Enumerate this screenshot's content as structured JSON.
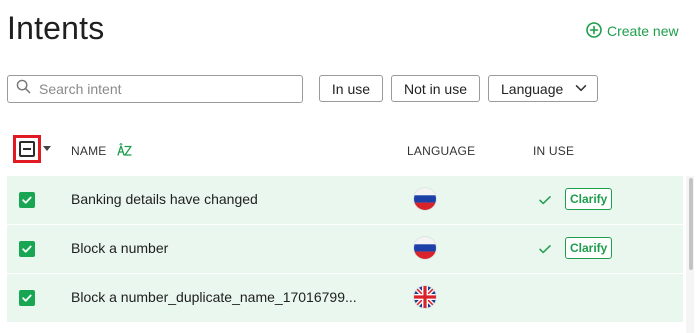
{
  "page": {
    "title": "Intents",
    "create_new_label": "Create new",
    "accent_color": "#1e9e4b"
  },
  "toolbar": {
    "search_placeholder": "Search intent",
    "search_value": "",
    "filter_in_use": "In use",
    "filter_not_in_use": "Not in use",
    "filter_language": "Language"
  },
  "table": {
    "columns": {
      "name": "NAME",
      "language": "LANGUAGE",
      "in_use": "IN USE"
    },
    "rows": [
      {
        "name": "Banking details have changed",
        "language_flag": "russia-flag",
        "selected": true,
        "in_use": true,
        "badge": "Clarify"
      },
      {
        "name": "Block a number",
        "language_flag": "russia-flag",
        "selected": true,
        "in_use": true,
        "badge": "Clarify"
      },
      {
        "name": "Block a number_duplicate_name_17016799...",
        "language_flag": "uk-flag",
        "selected": true,
        "in_use": false,
        "badge": ""
      }
    ]
  },
  "icons": {
    "create": "plus-circle-icon",
    "search": "search-icon",
    "dropdown": "chevron-down-icon",
    "sort": "sort-az-icon",
    "checkmark": "check-icon"
  }
}
